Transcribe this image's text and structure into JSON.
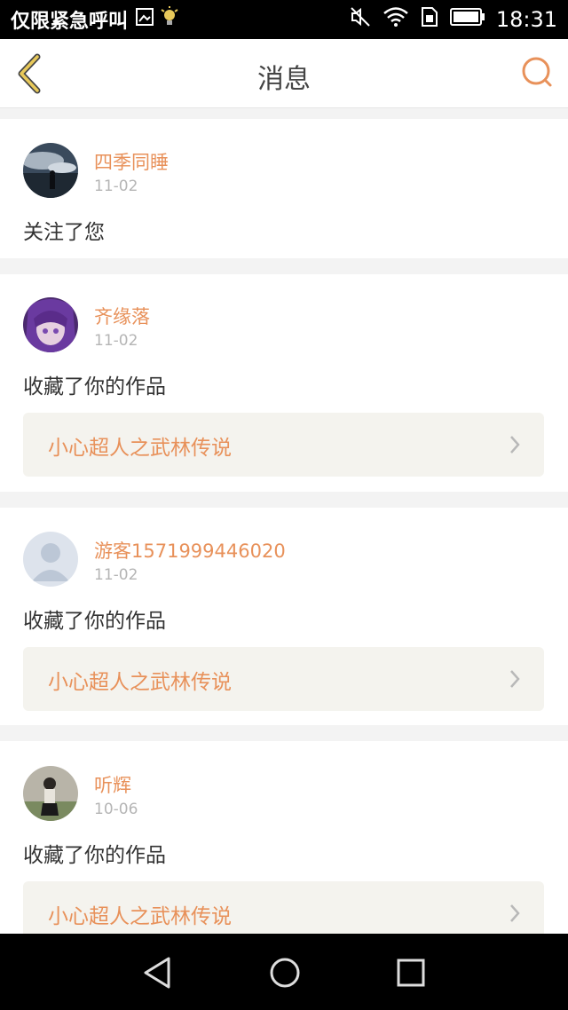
{
  "status_bar": {
    "carrier": "仅限紧急呼叫",
    "time": "18:31"
  },
  "header": {
    "title": "消息"
  },
  "messages": [
    {
      "username": "四季同睡",
      "date": "11-02",
      "action": "关注了您"
    },
    {
      "username": "齐缘落",
      "date": "11-02",
      "action": "收藏了你的作品",
      "work_title": "小心超人之武林传说"
    },
    {
      "username": "游客1571999446020",
      "date": "11-02",
      "action": "收藏了你的作品",
      "work_title": "小心超人之武林传说"
    },
    {
      "username": "听辉",
      "date": "10-06",
      "action": "收藏了你的作品",
      "work_title": "小心超人之武林传说"
    }
  ],
  "colors": {
    "accent": "#e8915a",
    "back_icon": "#e8c95a",
    "work_bg": "#f4f3ee"
  }
}
